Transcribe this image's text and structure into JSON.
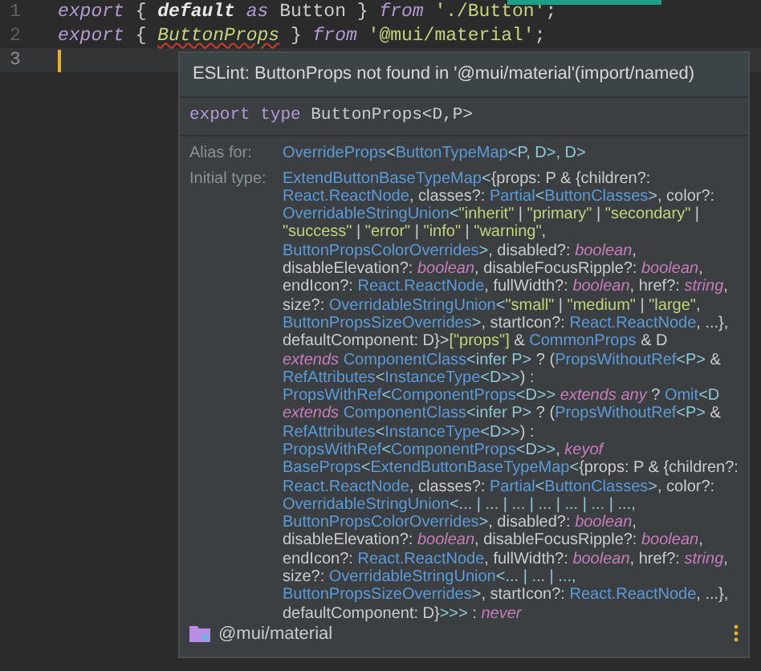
{
  "editor": {
    "lines": [
      {
        "number": "1",
        "current": false,
        "tokens": [
          {
            "text": "export",
            "kind": "keyword"
          },
          {
            "text": " { ",
            "kind": "plain"
          },
          {
            "text": "default",
            "kind": "bold"
          },
          {
            "text": " as",
            "kind": "keyword"
          },
          {
            "text": " Button } ",
            "kind": "plain"
          },
          {
            "text": "from",
            "kind": "keyword"
          },
          {
            "text": " './Button'",
            "kind": "string"
          },
          {
            "text": ";",
            "kind": "plain"
          }
        ]
      },
      {
        "number": "2",
        "current": false,
        "tokens": [
          {
            "text": "export",
            "kind": "keyword"
          },
          {
            "text": " { ",
            "kind": "plain"
          },
          {
            "text": "ButtonProps",
            "kind": "error"
          },
          {
            "text": " } ",
            "kind": "plain"
          },
          {
            "text": "from",
            "kind": "keyword"
          },
          {
            "text": " '@mui/material'",
            "kind": "string"
          },
          {
            "text": ";",
            "kind": "plain"
          }
        ]
      },
      {
        "number": "3",
        "current": true
      }
    ]
  },
  "popup": {
    "message": "ESLint: ButtonProps not found in '@mui/material'(import/named)",
    "signature": [
      {
        "text": "export type",
        "kind": "keyword"
      },
      {
        "text": " ButtonProps<D,P>",
        "kind": "plain"
      }
    ],
    "alias": {
      "label": "Alias for:",
      "lines": [
        [
          {
            "text": "OverrideProps",
            "kind": "type"
          },
          {
            "text": "<",
            "kind": "angle"
          },
          {
            "text": "ButtonTypeMap",
            "kind": "type"
          },
          {
            "text": "<P, D>, D>",
            "kind": "angle"
          }
        ]
      ]
    },
    "initial_type": {
      "label": "Initial type:",
      "lines": [
        [
          {
            "text": "ExtendButtonBaseTypeMap",
            "kind": "type"
          },
          {
            "text": "<",
            "kind": "angle"
          },
          {
            "text": "{props: P & {children?:",
            "kind": "plain"
          }
        ],
        [
          {
            "text": "React.ReactNode",
            "kind": "type"
          },
          {
            "text": ", classes?: ",
            "kind": "plain"
          },
          {
            "text": "Partial",
            "kind": "type"
          },
          {
            "text": "<",
            "kind": "angle"
          },
          {
            "text": "ButtonClasses",
            "kind": "type"
          },
          {
            "text": ">",
            "kind": "angle"
          },
          {
            "text": ", color?:",
            "kind": "plain"
          }
        ],
        [
          {
            "text": "OverridableStringUnion",
            "kind": "type"
          },
          {
            "text": "<",
            "kind": "angle"
          },
          {
            "text": "\"inherit\"",
            "kind": "string"
          },
          {
            "text": " | ",
            "kind": "plain"
          },
          {
            "text": "\"primary\"",
            "kind": "string"
          },
          {
            "text": " | ",
            "kind": "plain"
          },
          {
            "text": "\"secondary\"",
            "kind": "string"
          },
          {
            "text": " |",
            "kind": "plain"
          }
        ],
        [
          {
            "text": "\"success\"",
            "kind": "string"
          },
          {
            "text": " | ",
            "kind": "plain"
          },
          {
            "text": "\"error\"",
            "kind": "string"
          },
          {
            "text": " | ",
            "kind": "plain"
          },
          {
            "text": "\"info\"",
            "kind": "string"
          },
          {
            "text": " | ",
            "kind": "plain"
          },
          {
            "text": "\"warning\"",
            "kind": "string"
          },
          {
            "text": ",",
            "kind": "plain"
          }
        ],
        [
          {
            "text": "ButtonPropsColorOverrides",
            "kind": "type"
          },
          {
            "text": ">",
            "kind": "angle"
          },
          {
            "text": ", disabled?: ",
            "kind": "plain"
          },
          {
            "text": "boolean",
            "kind": "keyword"
          },
          {
            "text": ",",
            "kind": "plain"
          }
        ],
        [
          {
            "text": "disableElevation?: ",
            "kind": "plain"
          },
          {
            "text": "boolean",
            "kind": "keyword"
          },
          {
            "text": ", disableFocusRipple?: ",
            "kind": "plain"
          },
          {
            "text": "boolean",
            "kind": "keyword"
          },
          {
            "text": ",",
            "kind": "plain"
          }
        ],
        [
          {
            "text": "endIcon?: ",
            "kind": "plain"
          },
          {
            "text": "React.ReactNode",
            "kind": "type"
          },
          {
            "text": ", fullWidth?: ",
            "kind": "plain"
          },
          {
            "text": "boolean",
            "kind": "keyword"
          },
          {
            "text": ", href?: ",
            "kind": "plain"
          },
          {
            "text": "string",
            "kind": "keyword"
          },
          {
            "text": ",",
            "kind": "plain"
          }
        ],
        [
          {
            "text": "size?: ",
            "kind": "plain"
          },
          {
            "text": "OverridableStringUnion",
            "kind": "type"
          },
          {
            "text": "<",
            "kind": "angle"
          },
          {
            "text": "\"small\"",
            "kind": "string"
          },
          {
            "text": " | ",
            "kind": "plain"
          },
          {
            "text": "\"medium\"",
            "kind": "string"
          },
          {
            "text": " | ",
            "kind": "plain"
          },
          {
            "text": "\"large\"",
            "kind": "string"
          },
          {
            "text": ",",
            "kind": "plain"
          }
        ],
        [
          {
            "text": "ButtonPropsSizeOverrides",
            "kind": "type"
          },
          {
            "text": ">",
            "kind": "angle"
          },
          {
            "text": ", startIcon?: ",
            "kind": "plain"
          },
          {
            "text": "React.ReactNode",
            "kind": "type"
          },
          {
            "text": ", ...},",
            "kind": "plain"
          }
        ],
        [
          {
            "text": "defaultComponent: D}>",
            "kind": "plain"
          },
          {
            "text": "[\"props\"]",
            "kind": "string"
          },
          {
            "text": " & ",
            "kind": "plain"
          },
          {
            "text": "CommonProps",
            "kind": "type"
          },
          {
            "text": " & D",
            "kind": "plain"
          }
        ],
        [
          {
            "text": "extends ",
            "kind": "keyword"
          },
          {
            "text": "ComponentClass",
            "kind": "type"
          },
          {
            "text": "<infer P>",
            "kind": "angle"
          },
          {
            "text": " ? (",
            "kind": "plain"
          },
          {
            "text": "PropsWithoutRef",
            "kind": "type"
          },
          {
            "text": "<P>",
            "kind": "angle"
          },
          {
            "text": " &",
            "kind": "plain"
          }
        ],
        [
          {
            "text": "RefAttributes",
            "kind": "type"
          },
          {
            "text": "<",
            "kind": "angle"
          },
          {
            "text": "InstanceType",
            "kind": "type"
          },
          {
            "text": "<D>>",
            "kind": "angle"
          },
          {
            "text": ") :",
            "kind": "plain"
          }
        ],
        [
          {
            "text": "PropsWithRef",
            "kind": "type"
          },
          {
            "text": "<",
            "kind": "angle"
          },
          {
            "text": "ComponentProps",
            "kind": "type"
          },
          {
            "text": "<D>>",
            "kind": "angle"
          },
          {
            "text": " extends any",
            "kind": "keyword"
          },
          {
            "text": " ? ",
            "kind": "plain"
          },
          {
            "text": "Omit",
            "kind": "type"
          },
          {
            "text": "<D",
            "kind": "angle"
          }
        ],
        [
          {
            "text": "extends ",
            "kind": "keyword"
          },
          {
            "text": "ComponentClass",
            "kind": "type"
          },
          {
            "text": "<infer P>",
            "kind": "angle"
          },
          {
            "text": " ? (",
            "kind": "plain"
          },
          {
            "text": "PropsWithoutRef",
            "kind": "type"
          },
          {
            "text": "<P>",
            "kind": "angle"
          },
          {
            "text": " &",
            "kind": "plain"
          }
        ],
        [
          {
            "text": "RefAttributes",
            "kind": "type"
          },
          {
            "text": "<",
            "kind": "angle"
          },
          {
            "text": "InstanceType",
            "kind": "type"
          },
          {
            "text": "<D>>",
            "kind": "angle"
          },
          {
            "text": ") :",
            "kind": "plain"
          }
        ],
        [
          {
            "text": "PropsWithRef",
            "kind": "type"
          },
          {
            "text": "<",
            "kind": "angle"
          },
          {
            "text": "ComponentProps",
            "kind": "type"
          },
          {
            "text": "<D>>",
            "kind": "angle"
          },
          {
            "text": ",",
            "kind": "plain"
          },
          {
            "text": " keyof",
            "kind": "keyword"
          }
        ],
        [
          {
            "text": "BaseProps",
            "kind": "type"
          },
          {
            "text": "<",
            "kind": "angle"
          },
          {
            "text": "ExtendButtonBaseTypeMap",
            "kind": "type"
          },
          {
            "text": "<",
            "kind": "angle"
          },
          {
            "text": "{props: P & {children?:",
            "kind": "plain"
          }
        ],
        [
          {
            "text": "React.ReactNode",
            "kind": "type"
          },
          {
            "text": ", classes?: ",
            "kind": "plain"
          },
          {
            "text": "Partial",
            "kind": "type"
          },
          {
            "text": "<",
            "kind": "angle"
          },
          {
            "text": "ButtonClasses",
            "kind": "type"
          },
          {
            "text": ">",
            "kind": "angle"
          },
          {
            "text": ", color?:",
            "kind": "plain"
          }
        ],
        [
          {
            "text": "OverridableStringUnion",
            "kind": "type"
          },
          {
            "text": "<... | ... | ... | ... | ... | ... | ...,",
            "kind": "angle"
          }
        ],
        [
          {
            "text": "ButtonPropsColorOverrides",
            "kind": "type"
          },
          {
            "text": ">",
            "kind": "angle"
          },
          {
            "text": ", disabled?: ",
            "kind": "plain"
          },
          {
            "text": "boolean",
            "kind": "keyword"
          },
          {
            "text": ",",
            "kind": "plain"
          }
        ],
        [
          {
            "text": "disableElevation?: ",
            "kind": "plain"
          },
          {
            "text": "boolean",
            "kind": "keyword"
          },
          {
            "text": ", disableFocusRipple?: ",
            "kind": "plain"
          },
          {
            "text": "boolean",
            "kind": "keyword"
          },
          {
            "text": ",",
            "kind": "plain"
          }
        ],
        [
          {
            "text": "endIcon?: ",
            "kind": "plain"
          },
          {
            "text": "React.ReactNode",
            "kind": "type"
          },
          {
            "text": ", fullWidth?: ",
            "kind": "plain"
          },
          {
            "text": "boolean",
            "kind": "keyword"
          },
          {
            "text": ", href?: ",
            "kind": "plain"
          },
          {
            "text": "string",
            "kind": "keyword"
          },
          {
            "text": ",",
            "kind": "plain"
          }
        ],
        [
          {
            "text": "size?: ",
            "kind": "plain"
          },
          {
            "text": "OverridableStringUnion",
            "kind": "type"
          },
          {
            "text": "<... | ... | ...,",
            "kind": "angle"
          }
        ],
        [
          {
            "text": "ButtonPropsSizeOverrides",
            "kind": "type"
          },
          {
            "text": ">",
            "kind": "angle"
          },
          {
            "text": ", startIcon?: ",
            "kind": "plain"
          },
          {
            "text": "React.ReactNode",
            "kind": "type"
          },
          {
            "text": ", ...},",
            "kind": "plain"
          }
        ],
        [
          {
            "text": "defaultComponent: D}",
            "kind": "plain"
          },
          {
            "text": ">>>",
            "kind": "angle"
          },
          {
            "text": " : ",
            "kind": "plain"
          },
          {
            "text": "never",
            "kind": "keyword"
          }
        ]
      ]
    },
    "footer": {
      "module": "@mui/material"
    }
  }
}
